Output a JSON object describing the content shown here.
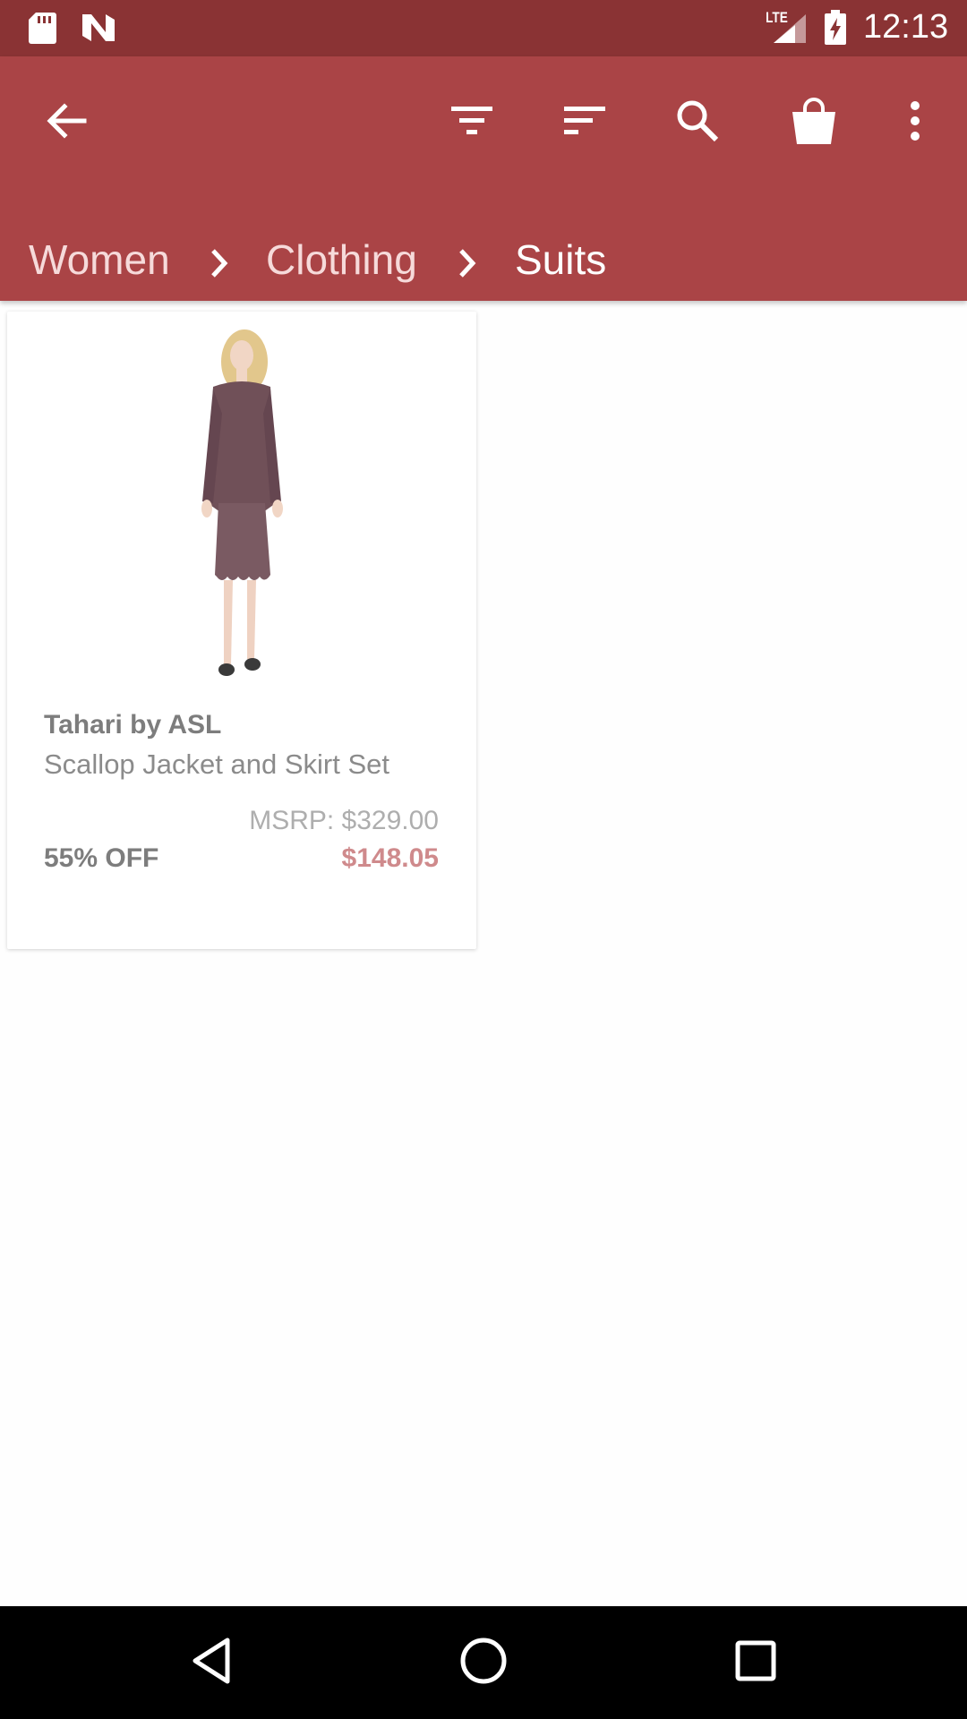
{
  "status_bar": {
    "time": "12:13",
    "network": "LTE",
    "icons": [
      "sd-card-icon",
      "n-app-icon",
      "lte-signal-icon",
      "battery-charging-icon"
    ]
  },
  "app_bar": {
    "background": "#aa4446",
    "icons": [
      "back-arrow-icon",
      "filter-icon",
      "sort-icon",
      "search-icon",
      "shopping-bag-icon",
      "more-vert-icon"
    ],
    "breadcrumb": [
      "Women",
      "Clothing",
      "Suits"
    ]
  },
  "products": [
    {
      "brand": "Tahari by ASL",
      "title": "Scallop Jacket and Skirt Set",
      "msrp": "MSRP: $329.00",
      "discount": "55% OFF",
      "price": "$148.05"
    }
  ],
  "nav_bar": {
    "icons": [
      "back-triangle-icon",
      "home-circle-icon",
      "recents-square-icon"
    ]
  }
}
